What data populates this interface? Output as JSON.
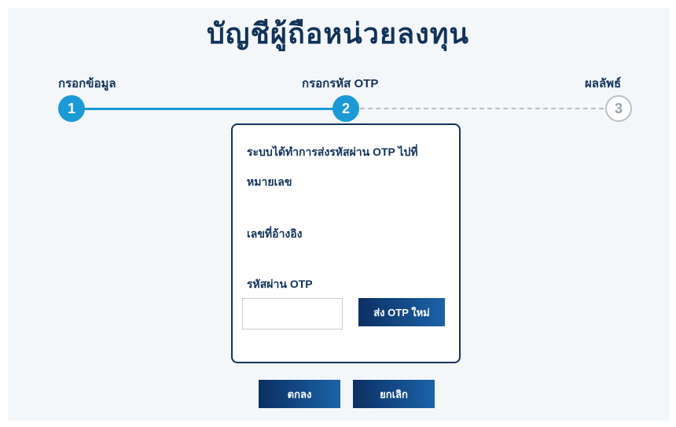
{
  "header": {
    "title": "บัญชีผู้ถือหน่วยลงทุน"
  },
  "steps": [
    {
      "number": "1",
      "label": "กรอกข้อมูล",
      "state": "completed"
    },
    {
      "number": "2",
      "label": "กรอกรหัส OTP",
      "state": "current"
    },
    {
      "number": "3",
      "label": "ผลลัพธ์",
      "state": "pending"
    }
  ],
  "card": {
    "message_line1": "ระบบได้ทำการส่งรหัสผ่าน OTP ไปที่",
    "message_line2": "หมายเลข",
    "reference_label": "เลขที่อ้างอิง",
    "otp_label": "รหัสผ่าน OTP",
    "otp_value": "",
    "resend_label": "ส่ง OTP ใหม่"
  },
  "actions": {
    "confirm_label": "ตกลง",
    "cancel_label": "ยกเลิก"
  },
  "colors": {
    "accent": "#1a9ad6",
    "navy": "#10335a",
    "button_dark": "#0c2f63",
    "button_light": "#1b63a8"
  }
}
